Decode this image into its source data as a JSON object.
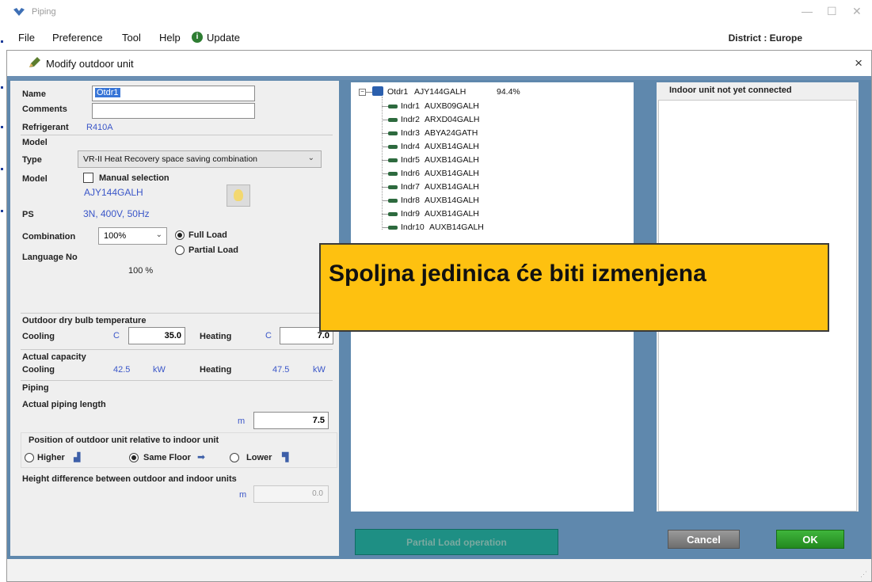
{
  "app": {
    "title": "Piping",
    "menu": [
      "File",
      "Preference",
      "Tool",
      "Help",
      "Update"
    ],
    "district": "District : Europe"
  },
  "dialog": {
    "title": "Modify outdoor unit",
    "close": "×"
  },
  "form": {
    "name_label": "Name",
    "name_value": "Otdr1",
    "comments_label": "Comments",
    "comments_value": "",
    "refrigerant_label": "Refrigerant",
    "refrigerant_value": "R410A",
    "model_section": "Model",
    "type_label": "Type",
    "type_value": "VR-II Heat Recovery space saving combination",
    "model_label": "Model",
    "manual_selection_label": "Manual selection",
    "manual_selection_checked": false,
    "model_value": "AJY144GALH",
    "ps_label": "PS",
    "ps_value": "3N, 400V, 50Hz",
    "combination_label": "Combination",
    "combination_value": "100%",
    "full_load_label": "Full Load",
    "partial_load_label": "Partial Load",
    "load_selected": "Full Load",
    "language_label": "Language No",
    "language_value": "100 %",
    "outdoor_temp_section": "Outdoor dry bulb temperature",
    "cooling_label": "Cooling",
    "heating_label": "Heating",
    "temp_unit": "C",
    "cooling_temp": "35.0",
    "heating_temp": "7.0",
    "capacity_section": "Actual capacity",
    "cooling_capacity": "42.5",
    "heating_capacity": "47.5",
    "capacity_unit": "kW",
    "piping_section": "Piping",
    "piping_length_label": "Actual piping length",
    "length_unit": "m",
    "piping_length": "7.5",
    "position_label": "Position of outdoor unit relative to indoor unit",
    "pos_higher": "Higher",
    "pos_same": "Same Floor",
    "pos_lower": "Lower",
    "pos_selected": "Same Floor",
    "height_diff_label": "Height difference between outdoor and indoor units",
    "height_diff_value": "0.0"
  },
  "tree": {
    "root": {
      "name": "Otdr1",
      "model": "AJY144GALH",
      "percent": "94.4%"
    },
    "children": [
      {
        "name": "Indr1",
        "model": "AUXB09GALH"
      },
      {
        "name": "Indr2",
        "model": "ARXD04GALH"
      },
      {
        "name": "Indr3",
        "model": "ABYA24GATH"
      },
      {
        "name": "Indr4",
        "model": "AUXB14GALH"
      },
      {
        "name": "Indr5",
        "model": "AUXB14GALH"
      },
      {
        "name": "Indr6",
        "model": "AUXB14GALH"
      },
      {
        "name": "Indr7",
        "model": "AUXB14GALH"
      },
      {
        "name": "Indr8",
        "model": "AUXB14GALH"
      },
      {
        "name": "Indr9",
        "model": "AUXB14GALH"
      },
      {
        "name": "Indr10",
        "model": "AUXB14GALH"
      }
    ]
  },
  "right_panel": {
    "title": "Indoor unit not yet connected"
  },
  "buttons": {
    "partial_load_operation": "Partial Load operation",
    "cancel": "Cancel",
    "ok": "OK"
  },
  "callout": {
    "text": "Spoljna jedinica će biti izmenjena"
  },
  "colors": {
    "accent_blue": "#5f88ad",
    "callout": "#fec110",
    "ok_green": "#23891f",
    "teal_button": "#1e8f84",
    "value_blue": "#3a56c8"
  }
}
